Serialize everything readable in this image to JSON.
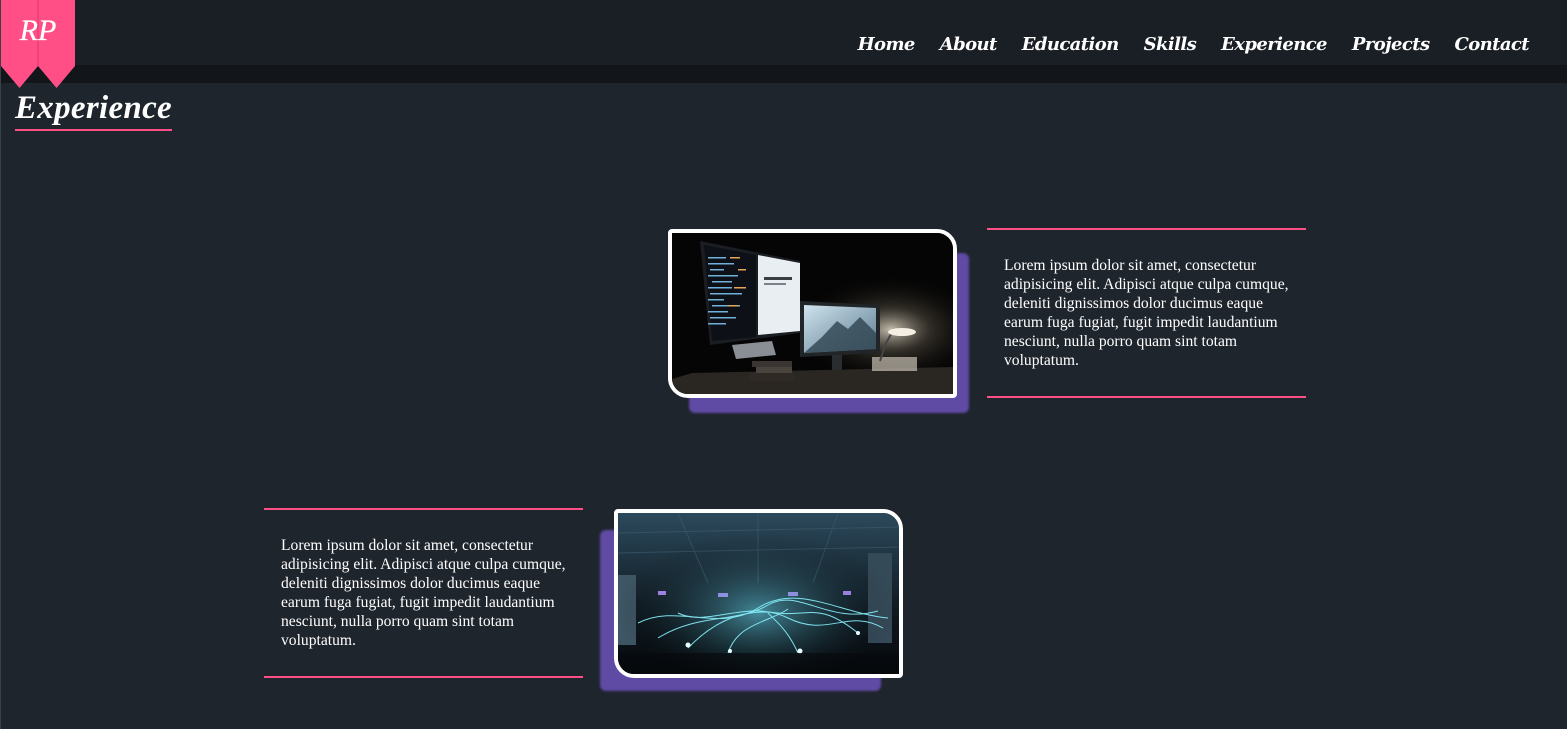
{
  "logo": {
    "text": "RP",
    "color": "#ff4f86"
  },
  "nav": {
    "items": [
      "Home",
      "About",
      "Education",
      "Skills",
      "Experience",
      "Projects",
      "Contact"
    ]
  },
  "section": {
    "title": "Experience",
    "accent": "#ff4f86"
  },
  "experiences": [
    {
      "image_icon": "desk-computers-image",
      "text": "Lorem ipsum dolor sit amet, consectetur adipisicing elit. Adipisci atque culpa cumque, deleniti dignissimos dolor ducimus eaque earum fuga fugiat, fugit impedit laudantium nesciunt, nulla porro quam sint totam voluptatum."
    },
    {
      "image_icon": "light-trails-image",
      "text": "Lorem ipsum dolor sit amet, consectetur adipisicing elit. Adipisci atque culpa cumque, deleniti dignissimos dolor ducimus eaque earum fuga fugiat, fugit impedit laudantium nesciunt, nulla porro quam sint totam voluptatum."
    }
  ],
  "colors": {
    "background": "#1f252d",
    "accent": "#ff4f86",
    "shadow": "#5f4aa4"
  }
}
